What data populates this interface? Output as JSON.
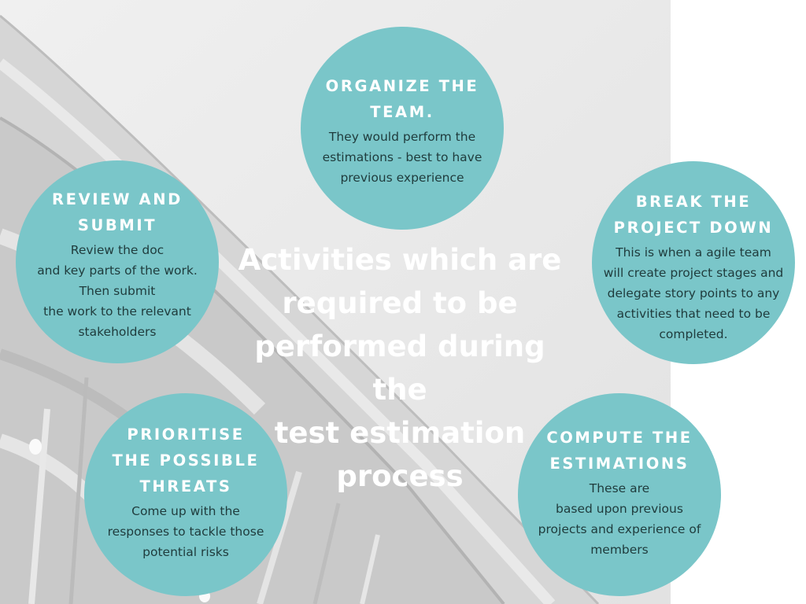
{
  "center_title": "Activities which are\nrequired to be\nperformed during the\ntest estimation\nprocess",
  "colors": {
    "circle_fill": "#7ac6c9",
    "title_text": "#ffffff",
    "body_text": "#1f3b3c",
    "photo_bg": "#dcdcdc"
  },
  "steps": [
    {
      "title": "ORGANIZE THE\nTEAM.",
      "body": "They would perform the\nestimations - best to have\nprevious experience"
    },
    {
      "title": "BREAK THE\nPROJECT DOWN",
      "body": "This is when a agile team\nwill create project stages and\ndelegate story points to any\nactivities that need to be\ncompleted."
    },
    {
      "title": "COMPUTE THE\nESTIMATIONS",
      "body": "These are\nbased upon previous\nprojects and experience of\nmembers"
    },
    {
      "title": "PRIORITISE\nTHE POSSIBLE\nTHREATS",
      "body": "Come up with the\nresponses to tackle those\npotential risks"
    },
    {
      "title": "REVIEW AND\nSUBMIT",
      "body": "Review the doc\nand key parts of the work.\nThen submit\nthe work to the relevant\nstakeholders"
    }
  ]
}
